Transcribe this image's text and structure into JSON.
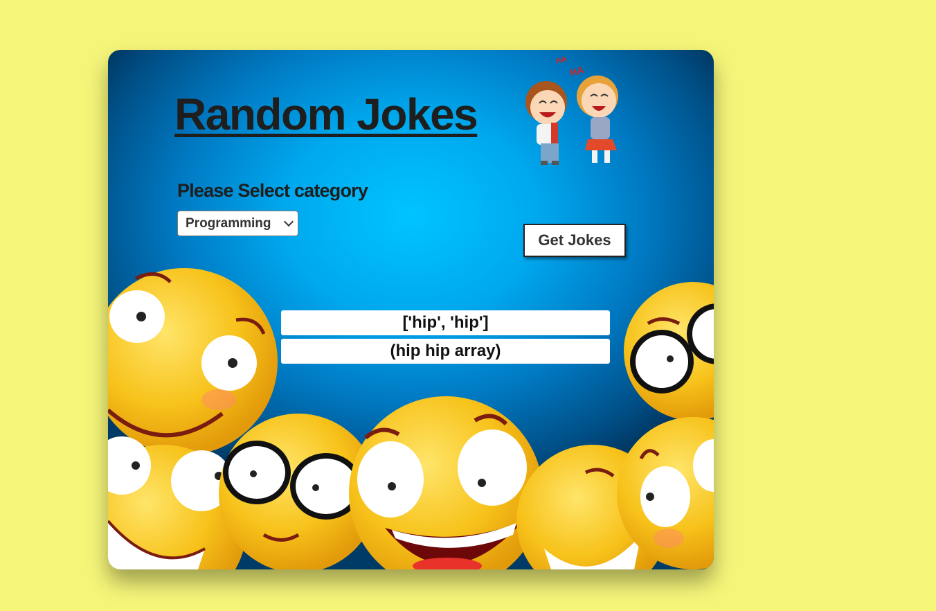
{
  "app": {
    "title": "Random Jokes",
    "category_label": "Please Select category",
    "category_selected": "Programming",
    "get_button_label": "Get Jokes"
  },
  "joke": {
    "setup": "['hip', 'hip']",
    "delivery": "(hip hip array)"
  },
  "illustration": {
    "laugh_text_1": "HA",
    "laugh_text_2": "HA"
  },
  "colors": {
    "page_bg": "#f5f57a",
    "card_center": "#00c4ff",
    "card_edge": "#003a66",
    "emoji_yellow": "#f7c21a"
  }
}
